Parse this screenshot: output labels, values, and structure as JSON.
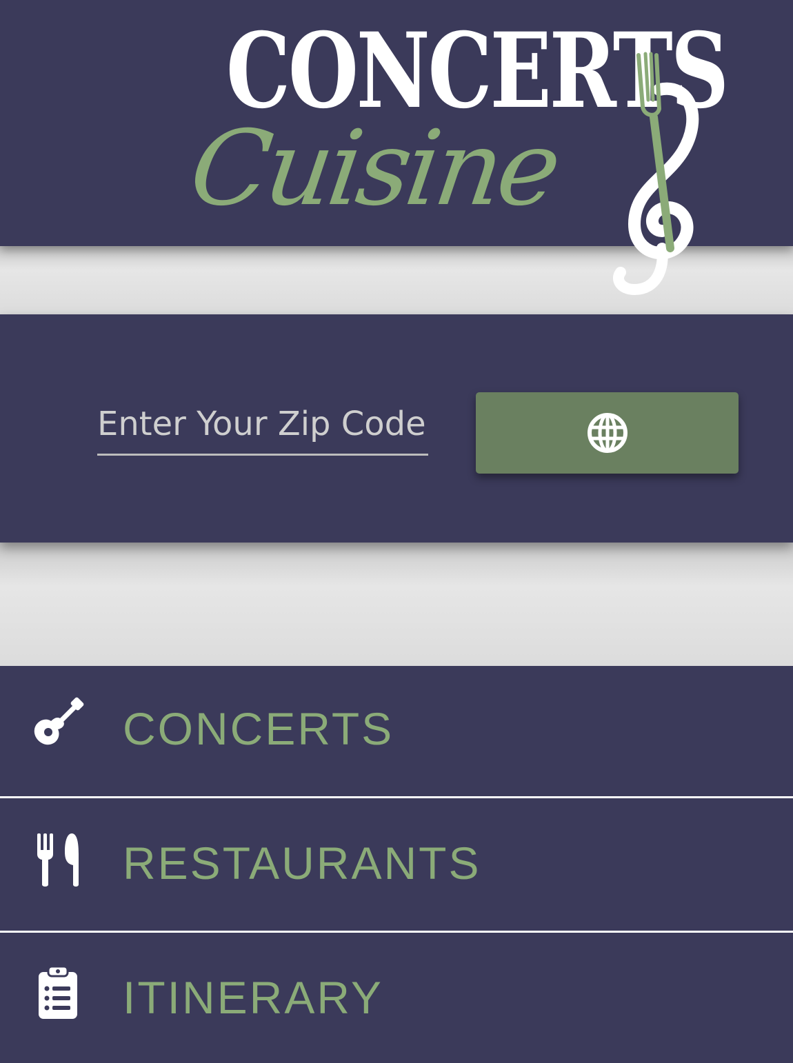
{
  "app": {
    "logo": {
      "line1": "CONCERTS",
      "line2": "Cuisine",
      "icon": "treble-clef-fork-icon"
    }
  },
  "zip": {
    "placeholder": "Enter Your Zip Code",
    "value": "",
    "button_icon": "globe-icon"
  },
  "menu": {
    "items": [
      {
        "label": "CONCERTS",
        "icon": "guitar-icon"
      },
      {
        "label": "RESTAURANTS",
        "icon": "utensils-icon"
      },
      {
        "label": "ITINERARY",
        "icon": "clipboard-list-icon"
      }
    ]
  },
  "colors": {
    "primary": "#3b3a5a",
    "accent": "#8bab78",
    "button": "#6a8060",
    "background": "#dcdcdc",
    "text_light": "#ffffff"
  }
}
